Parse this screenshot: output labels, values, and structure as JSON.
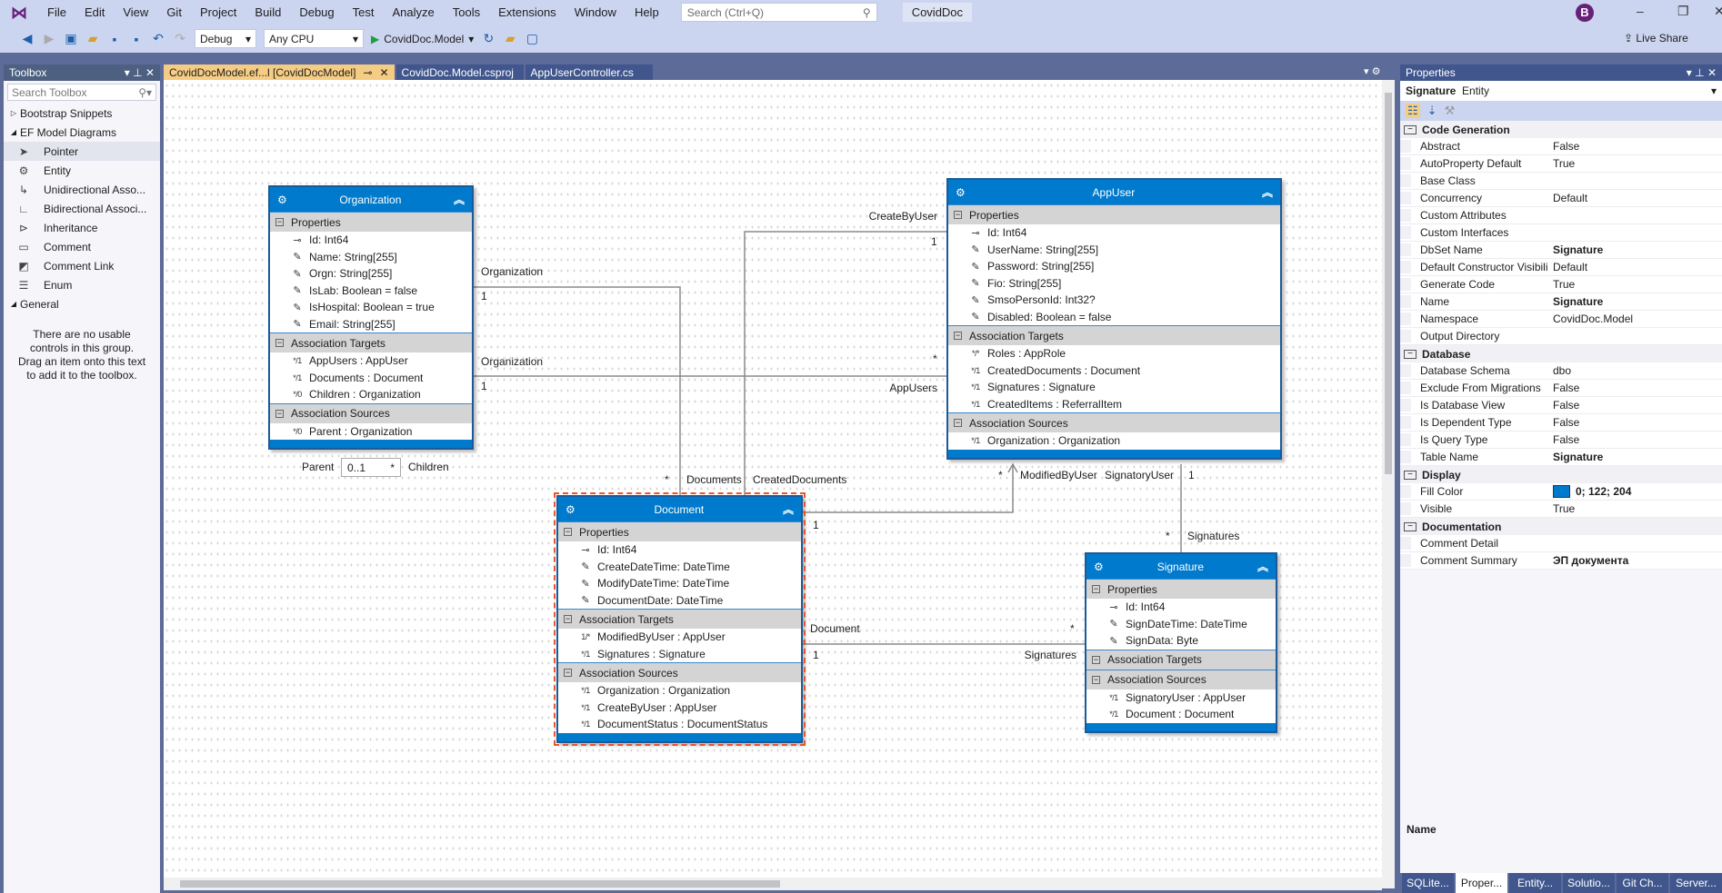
{
  "window": {
    "solution": "CovidDoc",
    "avatar": "B",
    "search_placeholder": "Search (Ctrl+Q)",
    "live_share": "Live Share"
  },
  "menu": [
    "File",
    "Edit",
    "View",
    "Git",
    "Project",
    "Build",
    "Debug",
    "Test",
    "Analyze",
    "Tools",
    "Extensions",
    "Window",
    "Help"
  ],
  "toolbar": {
    "config": "Debug",
    "platform": "Any CPU",
    "startup": "CovidDoc.Model"
  },
  "toolbox": {
    "title": "Toolbox",
    "search_placeholder": "Search Toolbox",
    "items": [
      {
        "label": "Bootstrap Snippets",
        "kind": "group",
        "expanded": false
      },
      {
        "label": "EF Model Diagrams",
        "kind": "group",
        "expanded": true
      },
      {
        "label": "Pointer",
        "icon": "pointer-icon",
        "selected": true
      },
      {
        "label": "Entity",
        "icon": "entity-icon"
      },
      {
        "label": "Unidirectional Asso...",
        "icon": "unidirectional-association-icon"
      },
      {
        "label": "Bidirectional Associ...",
        "icon": "bidirectional-association-icon"
      },
      {
        "label": "Inheritance",
        "icon": "inheritance-icon"
      },
      {
        "label": "Comment",
        "icon": "comment-icon"
      },
      {
        "label": "Comment Link",
        "icon": "comment-link-icon"
      },
      {
        "label": "Enum",
        "icon": "enum-icon"
      },
      {
        "label": "General",
        "kind": "group",
        "expanded": true
      }
    ],
    "empty_message": [
      "There are no usable",
      "controls in this group.",
      "Drag an item onto this text",
      "to add it to the toolbox."
    ]
  },
  "tabs": [
    {
      "label": "CovidDocModel.ef...l [CovidDocModel]",
      "active": true
    },
    {
      "label": "CovidDoc.Model.csproj"
    },
    {
      "label": "AppUserController.cs"
    }
  ],
  "diagram": {
    "entities": [
      {
        "name": "Organization",
        "sections": [
          {
            "title": "Properties",
            "items": [
              {
                "icon": "key",
                "text": "Id: Int64"
              },
              {
                "icon": "wrench",
                "text": "Name: String[255]"
              },
              {
                "icon": "wrench",
                "text": "Orgn: String[255]"
              },
              {
                "icon": "wrench",
                "text": "IsLab: Boolean = false"
              },
              {
                "icon": "wrench",
                "text": "IsHospital: Boolean = true"
              },
              {
                "icon": "wrench",
                "text": "Email: String[255]"
              }
            ]
          },
          {
            "title": "Association Targets",
            "items": [
              {
                "icon": "assoc",
                "mult": "*/1",
                "text": "AppUsers : AppUser"
              },
              {
                "icon": "assoc",
                "mult": "*/1",
                "text": "Documents : Document"
              },
              {
                "icon": "assoc",
                "mult": "*/0",
                "text": "Children : Organization"
              }
            ]
          },
          {
            "title": "Association Sources",
            "items": [
              {
                "icon": "assoc",
                "mult": "*/0",
                "text": "Parent : Organization"
              }
            ]
          }
        ]
      },
      {
        "name": "AppUser",
        "sections": [
          {
            "title": "Properties",
            "items": [
              {
                "icon": "key",
                "text": "Id: Int64"
              },
              {
                "icon": "wrench",
                "text": "UserName: String[255]"
              },
              {
                "icon": "wrench",
                "text": "Password: String[255]"
              },
              {
                "icon": "wrench",
                "text": "Fio: String[255]"
              },
              {
                "icon": "wrench",
                "text": "SmsoPersonId: Int32?"
              },
              {
                "icon": "wrench",
                "text": "Disabled: Boolean = false"
              }
            ]
          },
          {
            "title": "Association Targets",
            "items": [
              {
                "icon": "assoc",
                "mult": "*/*",
                "text": "Roles : AppRole"
              },
              {
                "icon": "assoc",
                "mult": "*/1",
                "text": "CreatedDocuments : Document"
              },
              {
                "icon": "assoc",
                "mult": "*/1",
                "text": "Signatures : Signature"
              },
              {
                "icon": "assoc",
                "mult": "*/1",
                "text": "CreatedItems : ReferralItem"
              }
            ]
          },
          {
            "title": "Association Sources",
            "items": [
              {
                "icon": "assoc",
                "mult": "*/1",
                "text": "Organization : Organization"
              }
            ]
          }
        ]
      },
      {
        "name": "Document",
        "selected": true,
        "sections": [
          {
            "title": "Properties",
            "items": [
              {
                "icon": "key",
                "text": "Id: Int64"
              },
              {
                "icon": "wrench",
                "text": "CreateDateTime: DateTime"
              },
              {
                "icon": "wrench",
                "text": "ModifyDateTime: DateTime"
              },
              {
                "icon": "wrench",
                "text": "DocumentDate: DateTime"
              }
            ]
          },
          {
            "title": "Association Targets",
            "items": [
              {
                "icon": "assoc",
                "mult": "1/*",
                "text": "ModifiedByUser : AppUser"
              },
              {
                "icon": "assoc",
                "mult": "*/1",
                "text": "Signatures : Signature"
              }
            ]
          },
          {
            "title": "Association Sources",
            "items": [
              {
                "icon": "assoc",
                "mult": "*/1",
                "text": "Organization : Organization"
              },
              {
                "icon": "assoc",
                "mult": "*/1",
                "text": "CreateByUser : AppUser"
              },
              {
                "icon": "assoc",
                "mult": "*/1",
                "text": "DocumentStatus : DocumentStatus"
              }
            ]
          }
        ]
      },
      {
        "name": "Signature",
        "sections": [
          {
            "title": "Properties",
            "items": [
              {
                "icon": "key",
                "text": "Id: Int64"
              },
              {
                "icon": "wrench",
                "text": "SignDateTime: DateTime"
              },
              {
                "icon": "wrench",
                "text": "SignData: Byte"
              }
            ]
          },
          {
            "title": "Association Targets",
            "items": []
          },
          {
            "title": "Association Sources",
            "items": [
              {
                "icon": "assoc",
                "mult": "*/1",
                "text": "SignatoryUser : AppUser"
              },
              {
                "icon": "assoc",
                "mult": "*/1",
                "text": "Document : Document"
              }
            ]
          }
        ]
      }
    ],
    "labels": [
      "Organization",
      "1",
      "Organization",
      "1",
      "CreateByUser",
      "1",
      "*",
      "AppUsers",
      "*",
      "Documents",
      "CreatedDocuments",
      "*",
      "ModifiedByUser",
      "SignatoryUser",
      "1",
      "1",
      "*",
      "Signatures",
      "Document",
      "*",
      "1",
      "Signatures"
    ],
    "self_assoc": {
      "left": "Parent",
      "multiplicity": "0..1",
      "right": "Children"
    }
  },
  "properties": {
    "title": "Properties",
    "object_name": "Signature",
    "object_type": "Entity",
    "categories": [
      {
        "name": "Code Generation",
        "rows": [
          {
            "name": "Abstract",
            "value": "False"
          },
          {
            "name": "AutoProperty Default",
            "value": "True"
          },
          {
            "name": "Base Class",
            "value": ""
          },
          {
            "name": "Concurrency",
            "value": "Default"
          },
          {
            "name": "Custom Attributes",
            "value": ""
          },
          {
            "name": "Custom Interfaces",
            "value": ""
          },
          {
            "name": "DbSet Name",
            "value": "Signature",
            "bold": true
          },
          {
            "name": "Default Constructor Visibility",
            "value": "Default"
          },
          {
            "name": "Generate Code",
            "value": "True"
          },
          {
            "name": "Name",
            "value": "Signature",
            "bold": true
          },
          {
            "name": "Namespace",
            "value": "CovidDoc.Model"
          },
          {
            "name": "Output Directory",
            "value": ""
          }
        ]
      },
      {
        "name": "Database",
        "rows": [
          {
            "name": "Database Schema",
            "value": "dbo"
          },
          {
            "name": "Exclude From Migrations",
            "value": "False"
          },
          {
            "name": "Is Database View",
            "value": "False"
          },
          {
            "name": "Is Dependent Type",
            "value": "False"
          },
          {
            "name": "Is Query Type",
            "value": "False"
          },
          {
            "name": "Table Name",
            "value": "Signature",
            "bold": true
          }
        ]
      },
      {
        "name": "Display",
        "rows": [
          {
            "name": "Fill Color",
            "value": "0; 122; 204",
            "bold": true,
            "swatch": "#007acc"
          },
          {
            "name": "Visible",
            "value": "True"
          }
        ]
      },
      {
        "name": "Documentation",
        "rows": [
          {
            "name": "Comment Detail",
            "value": ""
          },
          {
            "name": "Comment Summary",
            "value": "ЭП документа",
            "bold": true
          }
        ]
      }
    ],
    "description_title": "Name"
  },
  "bottom_tabs": [
    {
      "label": "SQLite..."
    },
    {
      "label": "Proper...",
      "active": true
    },
    {
      "label": "Entity..."
    },
    {
      "label": "Solutio..."
    },
    {
      "label": "Git Ch..."
    },
    {
      "label": "Server..."
    }
  ],
  "colors": {
    "entity_header": "#007acc",
    "selection": "#e8572a",
    "active_tab": "#f5cc84"
  }
}
